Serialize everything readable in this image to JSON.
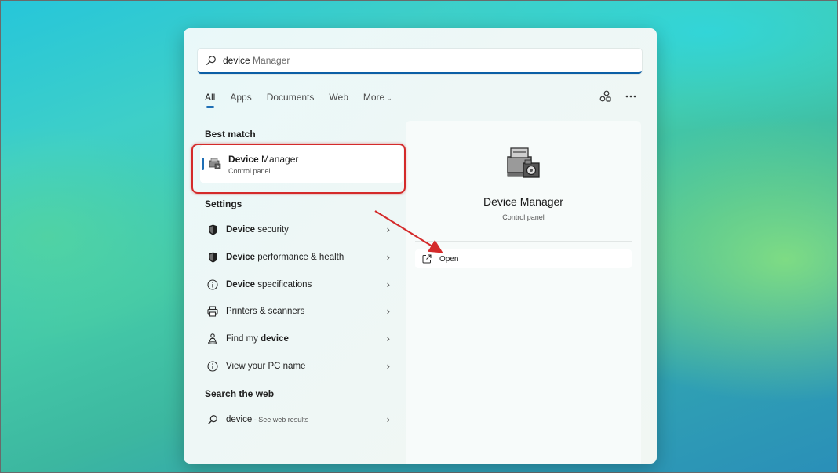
{
  "search": {
    "typed": "device",
    "completion": " Manager"
  },
  "tabs": [
    {
      "label": "All"
    },
    {
      "label": "Apps"
    },
    {
      "label": "Documents"
    },
    {
      "label": "Web"
    },
    {
      "label": "More"
    }
  ],
  "best_match": {
    "heading": "Best match",
    "title_bold": "Device",
    "title_rest": " Manager",
    "subtitle": "Control panel"
  },
  "settings": {
    "heading": "Settings",
    "items": [
      {
        "bold": "Device",
        "rest": " security",
        "icon": "shield-icon"
      },
      {
        "bold": "Device",
        "rest": " performance & health",
        "icon": "shield-icon"
      },
      {
        "bold": "Device",
        "rest": " specifications",
        "icon": "info-icon"
      },
      {
        "bold": "",
        "rest": "Printers & scanners",
        "icon": "printer-icon"
      },
      {
        "pre": "Find my ",
        "bold": "device",
        "icon": "person-location-icon"
      },
      {
        "bold": "",
        "rest": "View your PC name",
        "icon": "info-icon"
      }
    ]
  },
  "web": {
    "heading": "Search the web",
    "query": "device",
    "suffix": " - See web results"
  },
  "preview": {
    "title": "Device Manager",
    "subtitle": "Control panel",
    "open_label": "Open"
  },
  "colors": {
    "accent": "#1f6fb5",
    "highlight_outline": "#d42a2a"
  }
}
